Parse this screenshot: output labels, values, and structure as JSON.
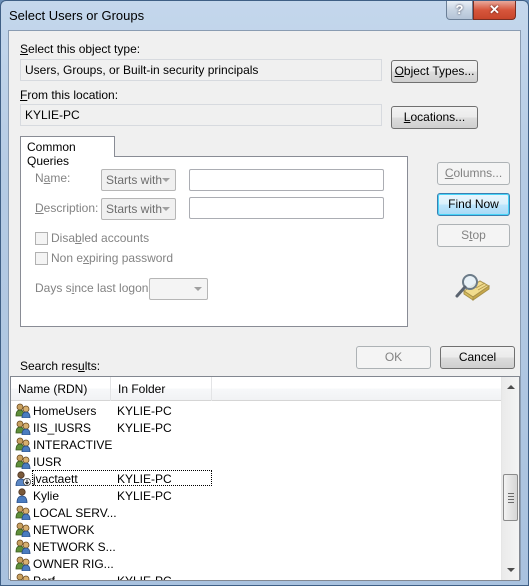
{
  "window": {
    "title": "Select Users or Groups",
    "help_glyph": "?",
    "close_glyph": "✕"
  },
  "object_type": {
    "label_prefix": "",
    "label_accel": "S",
    "label_rest": "elect this object type:",
    "value": "Users, Groups, or Built-in security principals",
    "button_accel": "O",
    "button_rest": "bject Types..."
  },
  "location": {
    "label_accel": "F",
    "label_rest": "rom this location:",
    "value": "KYLIE-PC",
    "button_accel": "L",
    "button_rest": "ocations..."
  },
  "queries": {
    "tab_label": "Common Queries",
    "name_label_pre": "N",
    "name_label_accel": "a",
    "name_label_post": "me:",
    "name_mode": "Starts with",
    "name_value": "",
    "desc_label_accel": "D",
    "desc_label_post": "escription:",
    "desc_mode": "Starts with",
    "desc_value": "",
    "disabled_pre": "Disa",
    "disabled_accel": "b",
    "disabled_post": "led accounts",
    "disabled_checked": false,
    "nonexp_pre": "Non e",
    "nonexp_accel": "x",
    "nonexp_post": "piring password",
    "nonexp_checked": false,
    "days_pre": "Days s",
    "days_accel": "i",
    "days_post": "nce last logon:",
    "days_value": ""
  },
  "side_buttons": {
    "columns_accel": "C",
    "columns_rest": "olumns...",
    "find_now": "Find Now",
    "stop_pre": "S",
    "stop_accel": "t",
    "stop_post": "op"
  },
  "footer": {
    "results_pre": "Search res",
    "results_accel": "u",
    "results_post": "lts:",
    "ok": "OK",
    "cancel": "Cancel"
  },
  "results": {
    "columns": [
      "Name (RDN)",
      "In Folder"
    ],
    "rows": [
      {
        "name": "HomeUsers",
        "folder": "KYLIE-PC",
        "icon": "group-icon"
      },
      {
        "name": "IIS_IUSRS",
        "folder": "KYLIE-PC",
        "icon": "group-icon"
      },
      {
        "name": "INTERACTIVE",
        "folder": "",
        "icon": "group-icon"
      },
      {
        "name": "IUSR",
        "folder": "",
        "icon": "group-icon"
      },
      {
        "name": "jvactaett",
        "folder": "KYLIE-PC",
        "icon": "user-disabled-icon",
        "focused": true
      },
      {
        "name": "Kylie",
        "folder": "KYLIE-PC",
        "icon": "user-icon"
      },
      {
        "name": "LOCAL SERV...",
        "folder": "",
        "icon": "group-icon"
      },
      {
        "name": "NETWORK",
        "folder": "",
        "icon": "group-icon"
      },
      {
        "name": "NETWORK S...",
        "folder": "",
        "icon": "group-icon"
      },
      {
        "name": "OWNER RIG...",
        "folder": "",
        "icon": "group-icon"
      },
      {
        "name": "Perf...",
        "folder": "KYLIE-PC",
        "icon": "group-icon"
      }
    ]
  }
}
